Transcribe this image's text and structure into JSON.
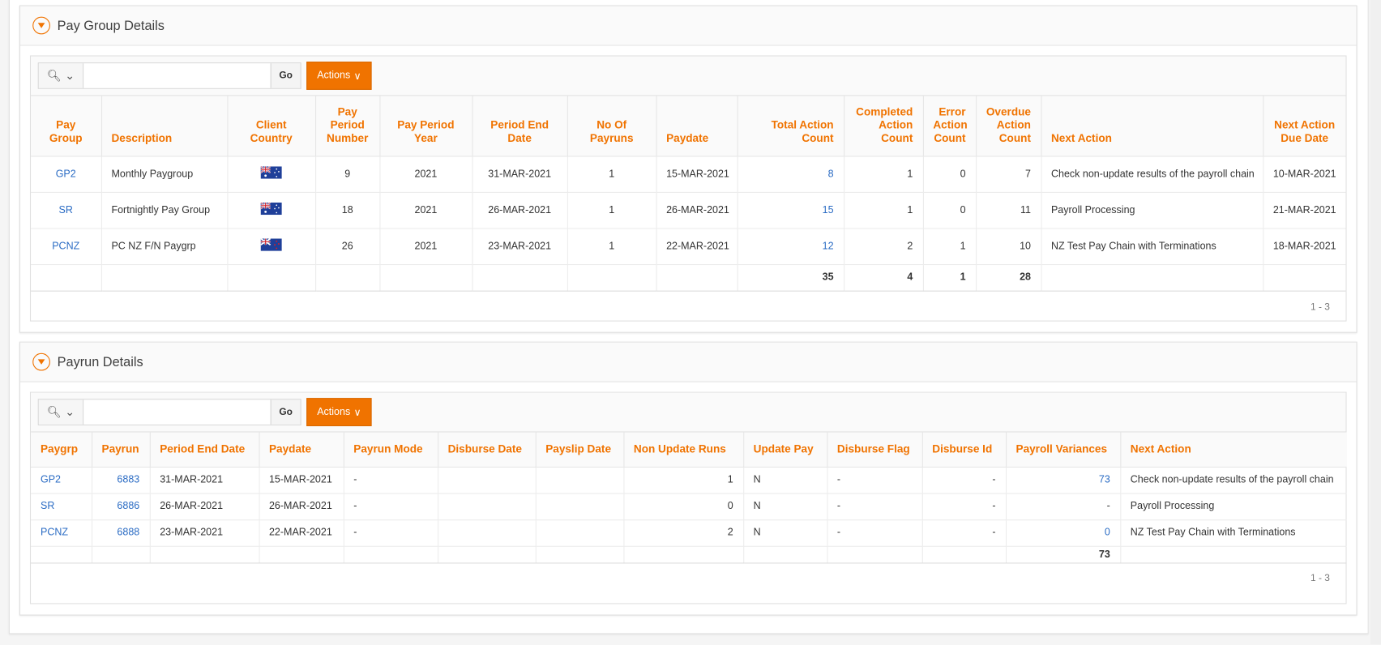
{
  "colors": {
    "accent": "#f07300",
    "link": "#2b6cc4"
  },
  "pay_group": {
    "title": "Pay Group Details",
    "search_placeholder": "",
    "go_label": "Go",
    "actions_label": "Actions",
    "columns": [
      "Pay Group",
      "Description",
      "Client Country",
      "Pay Period Number",
      "Pay Period Year",
      "Period End Date",
      "No Of Payruns",
      "Paydate",
      "Total Action Count",
      "Completed Action Count",
      "Error Action Count",
      "Overdue Action Count",
      "Next Action",
      "Next Action Due Date"
    ],
    "rows": [
      [
        "GP2",
        "Monthly Paygroup",
        "flag-australia",
        "9",
        "2021",
        "31-MAR-2021",
        "1",
        "15-MAR-2021",
        "8",
        "1",
        "0",
        "7",
        "Check non-update results of the payroll chain",
        "10-MAR-2021"
      ],
      [
        "SR",
        "Fortnightly Pay Group",
        "flag-australia",
        "18",
        "2021",
        "26-MAR-2021",
        "1",
        "26-MAR-2021",
        "15",
        "1",
        "0",
        "11",
        "Payroll Processing",
        "21-MAR-2021"
      ],
      [
        "PCNZ",
        "PC NZ F/N Paygrp",
        "flag-new-zealand",
        "26",
        "2021",
        "23-MAR-2021",
        "1",
        "22-MAR-2021",
        "12",
        "2",
        "1",
        "10",
        "NZ Test Pay Chain with Terminations",
        "18-MAR-2021"
      ]
    ],
    "totals": [
      "",
      "",
      "",
      "",
      "",
      "",
      "",
      "",
      "35",
      "4",
      "1",
      "28",
      "",
      ""
    ],
    "pagination": "1 - 3"
  },
  "payrun": {
    "title": "Payrun Details",
    "search_placeholder": "",
    "go_label": "Go",
    "actions_label": "Actions",
    "columns": [
      "Paygrp",
      "Payrun",
      "Period End Date",
      "Paydate",
      "Payrun Mode",
      "Disburse Date",
      "Payslip Date",
      "Non Update Runs",
      "Update Pay",
      "Disburse Flag",
      "Disburse Id",
      "Payroll Variances",
      "Next Action"
    ],
    "rows": [
      [
        "GP2",
        "6883",
        "31-MAR-2021",
        "15-MAR-2021",
        "-",
        "",
        "",
        "1",
        "N",
        "-",
        "-",
        "73",
        "Check non-update results of the payroll chain"
      ],
      [
        "SR",
        "6886",
        "26-MAR-2021",
        "26-MAR-2021",
        "-",
        "",
        "",
        "0",
        "N",
        "-",
        "-",
        "-",
        "Payroll Processing"
      ],
      [
        "PCNZ",
        "6888",
        "23-MAR-2021",
        "22-MAR-2021",
        "-",
        "",
        "",
        "2",
        "N",
        "-",
        "-",
        "0",
        "NZ Test Pay Chain with Terminations"
      ]
    ],
    "totals": [
      "",
      "",
      "",
      "",
      "",
      "",
      "",
      "",
      "",
      "",
      "",
      "73",
      ""
    ],
    "pagination": "1 - 3"
  }
}
